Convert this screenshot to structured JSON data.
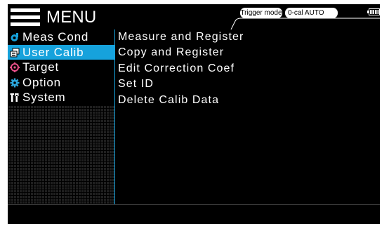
{
  "header": {
    "title": "MENU",
    "trigger_mode": "Trigger mode",
    "zero_cal": "0-cal AUTO",
    "battery_icon": "battery-icon"
  },
  "sidebar": {
    "items": [
      {
        "label": "Meas Cond",
        "icon": "meas-cond-icon",
        "active": false
      },
      {
        "label": "User Calib",
        "icon": "user-calib-icon",
        "active": true
      },
      {
        "label": "Target",
        "icon": "target-icon",
        "active": false
      },
      {
        "label": "Option",
        "icon": "option-icon",
        "active": false
      },
      {
        "label": "System",
        "icon": "system-icon",
        "active": false
      }
    ]
  },
  "content": {
    "items": [
      "Measure and Register",
      "Copy and Register",
      "Edit Correction Coef",
      "Set ID",
      "Delete Calib Data"
    ]
  },
  "colors": {
    "accent": "#16a2dc",
    "meas_icon": "#16a2dc",
    "target_icon": "#e8508a",
    "option_icon": "#2ca6dc"
  }
}
